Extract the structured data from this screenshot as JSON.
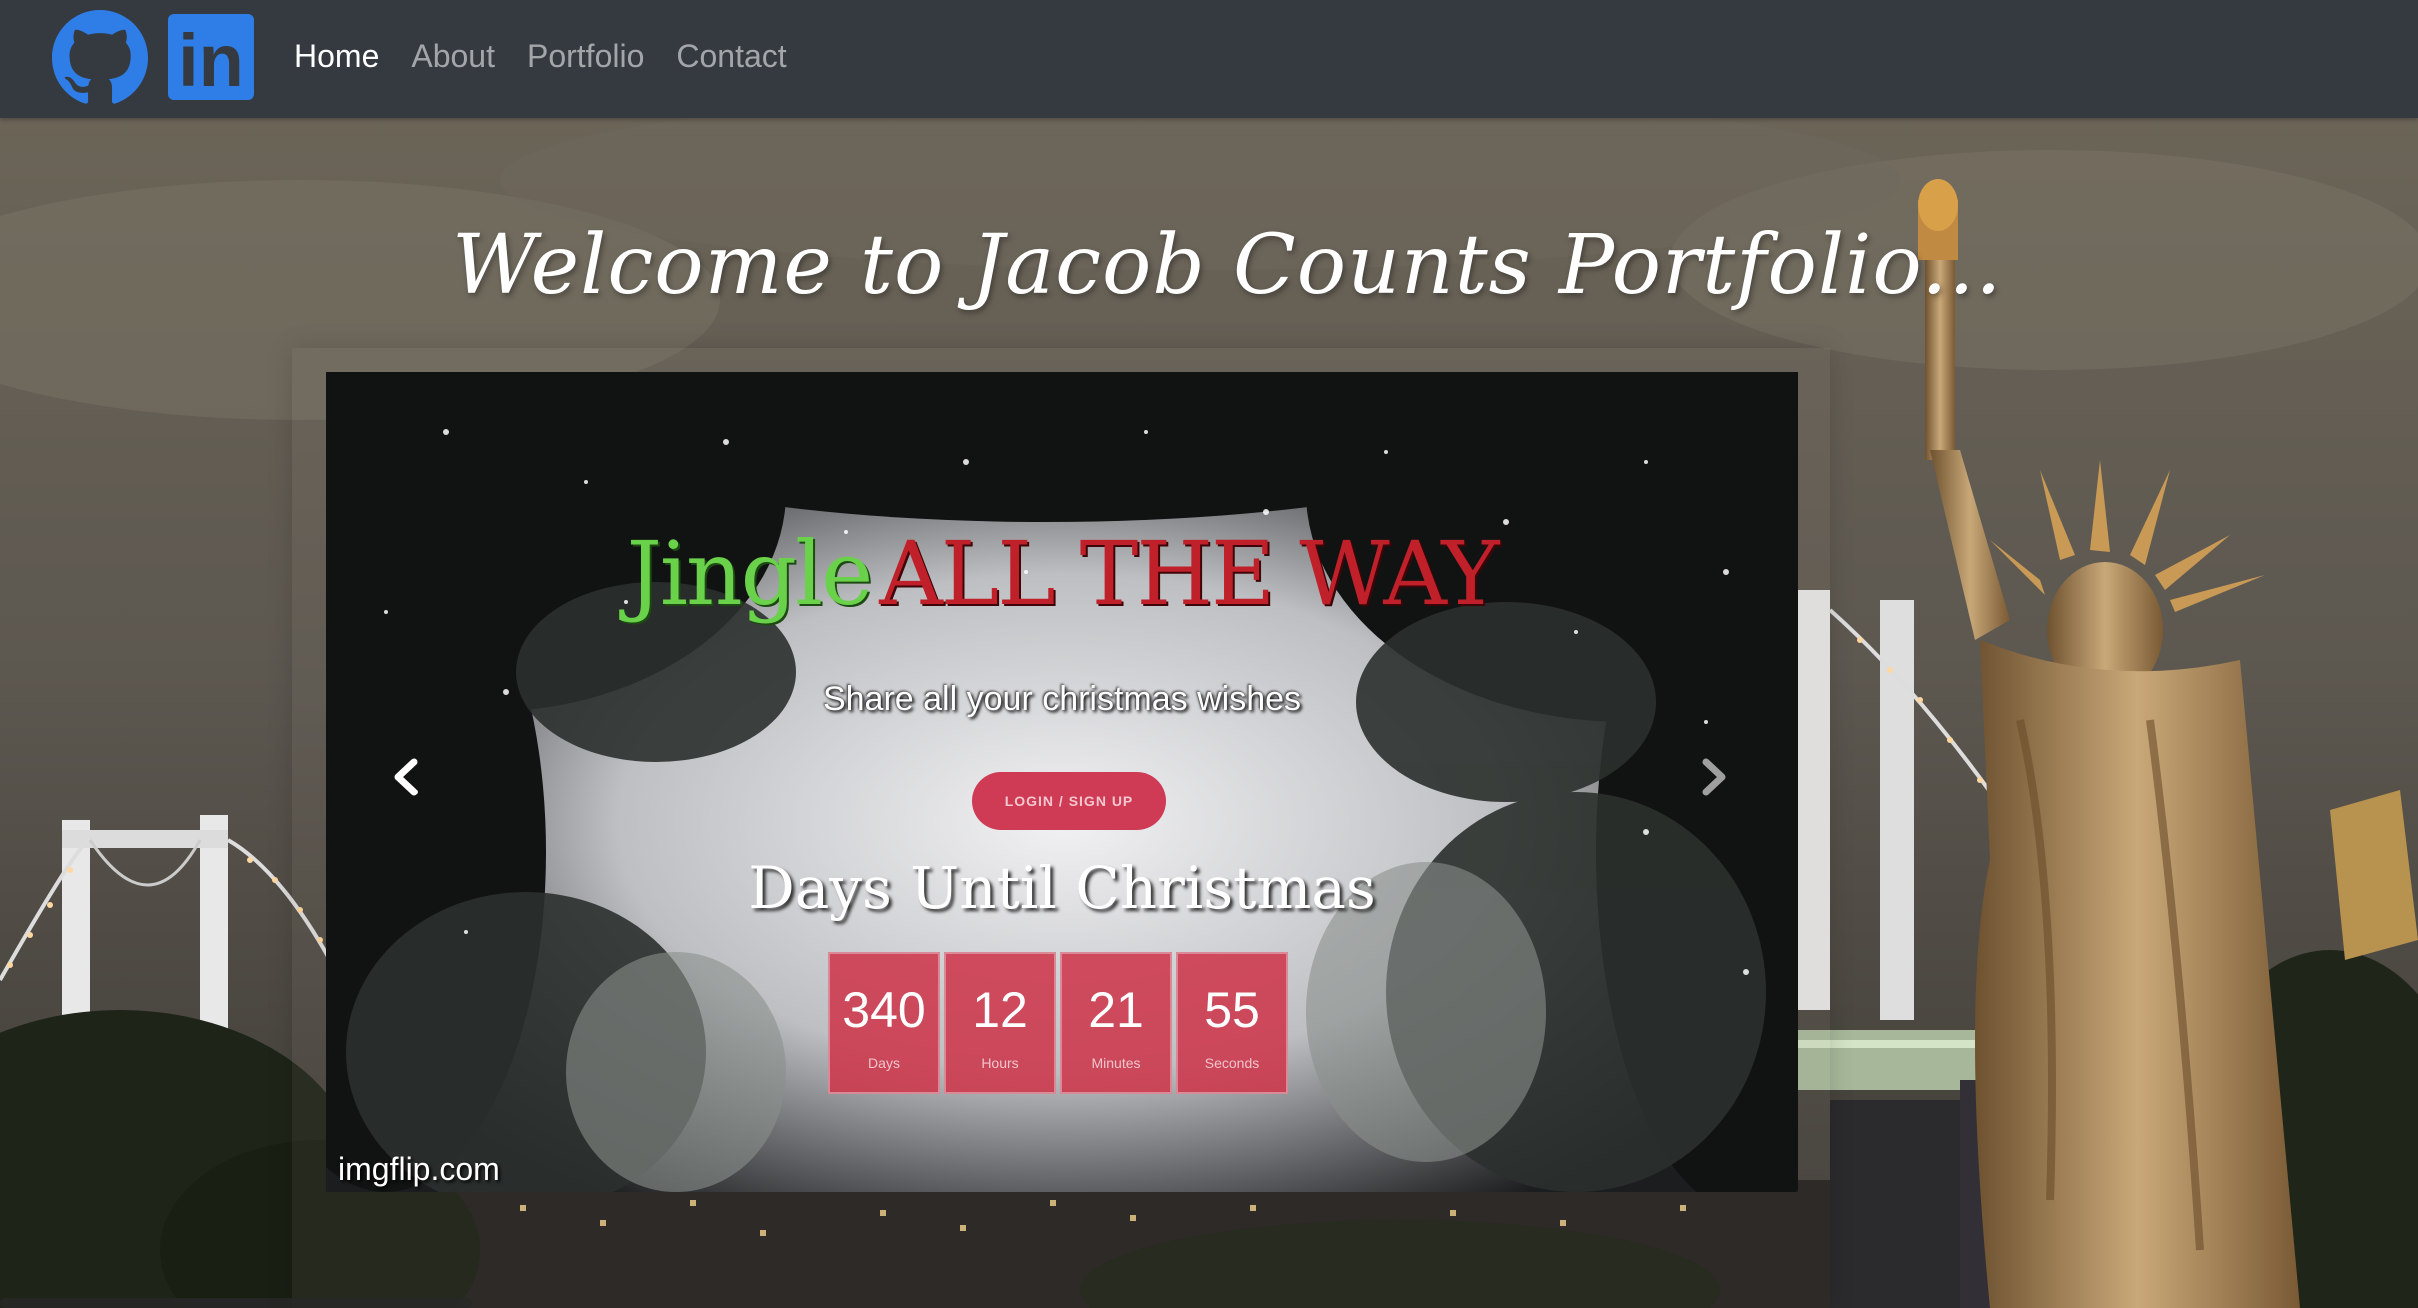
{
  "nav": {
    "links": [
      {
        "label": "Home",
        "active": true
      },
      {
        "label": "About",
        "active": false
      },
      {
        "label": "Portfolio",
        "active": false
      },
      {
        "label": "Contact",
        "active": false
      }
    ],
    "icons": [
      "github-icon",
      "linkedin-icon"
    ],
    "linkedin_text": "in",
    "background": "#343a40",
    "linkedin_color": "#2f7ee8",
    "github_color": "#2f7ee8"
  },
  "hero": {
    "heading": "Welcome to Jacob Counts Portfolio..."
  },
  "carousel": {
    "slide": {
      "title_word1": "Jingle",
      "title_word2": "ALL THE WAY",
      "subtitle": "Share all your christmas wishes",
      "button_label": "LOGIN / SIGN UP",
      "countdown_title": "Days Until Christmas",
      "countdown": [
        {
          "value": "340",
          "label": "Days"
        },
        {
          "value": "12",
          "label": "Hours"
        },
        {
          "value": "21",
          "label": "Minutes"
        },
        {
          "value": "55",
          "label": "Seconds"
        }
      ],
      "watermark": "imgflip.com"
    },
    "controls": [
      "chevron-left-icon",
      "chevron-right-icon"
    ]
  },
  "colors": {
    "accent_red": "#cf3a55",
    "jingle_green": "#6ad24a",
    "jingle_red": "#c0202a"
  }
}
